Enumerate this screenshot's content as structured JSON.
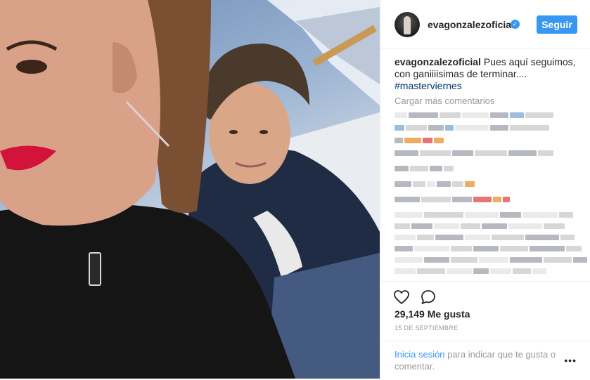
{
  "post": {
    "username": "evagonzalezoficial",
    "follow_label": "Seguir",
    "caption_user": "evagonzalezoficial",
    "caption_text": "Pues aquí seguimos, con ganiiiisimas de terminar....",
    "hashtag": "#masterviernes",
    "load_more_label": "Cargar más comentarios",
    "likes_text": "29,149 Me gusta",
    "date_text": "15 DE SEPTIEMBRE",
    "login_link": "Iniciа sesión",
    "login_rest": " para indicar que te gusta o comentar.",
    "more_options": "•••"
  },
  "icons": [
    "verified-icon",
    "heart-icon",
    "comment-icon",
    "more-options-icon"
  ],
  "colors": {
    "accent": "#3897f0",
    "hashtag": "#003569",
    "muted": "#999999",
    "text": "#262626"
  }
}
